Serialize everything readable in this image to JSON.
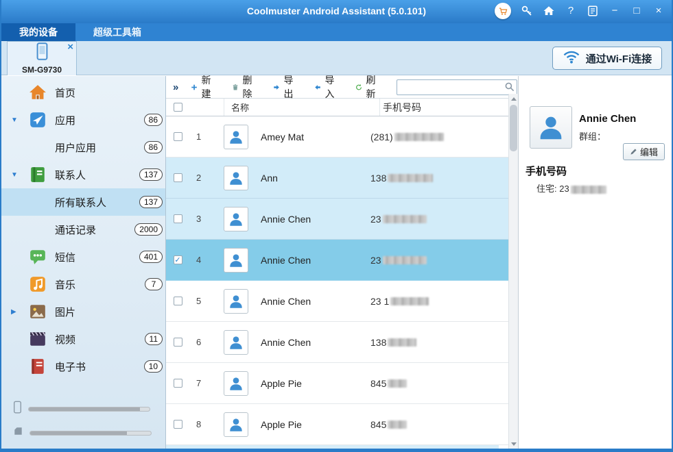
{
  "window": {
    "title": "Coolmuster Android Assistant (5.0.101)"
  },
  "icons": {
    "close": "×",
    "minimize": "−",
    "maximize": "□",
    "help": "?",
    "device_close": "×",
    "arrow_down": "▼",
    "arrow_right": "▶",
    "collapse": "»",
    "check": "✓"
  },
  "tabs": [
    {
      "label": "我的设备",
      "active": true
    },
    {
      "label": "超级工具箱",
      "active": false
    }
  ],
  "device": {
    "name": "SM-G9730"
  },
  "wifi_button": {
    "label": "通过Wi-Fi连接"
  },
  "sidebar": {
    "items": [
      {
        "label": "首页",
        "badge": "",
        "icon": "home"
      },
      {
        "label": "应用",
        "badge": "86",
        "icon": "apps",
        "arrow": "down"
      },
      {
        "label": "用户应用",
        "badge": "86"
      },
      {
        "label": "联系人",
        "badge": "137",
        "icon": "contacts",
        "arrow": "down"
      },
      {
        "label": "所有联系人",
        "badge": "137",
        "selected": true
      },
      {
        "label": "通话记录",
        "badge": "2000"
      },
      {
        "label": "短信",
        "badge": "401",
        "icon": "sms"
      },
      {
        "label": "音乐",
        "badge": "7",
        "icon": "music"
      },
      {
        "label": "图片",
        "badge": "",
        "icon": "photos",
        "arrow": "right"
      },
      {
        "label": "视频",
        "badge": "11",
        "icon": "videos"
      },
      {
        "label": "电子书",
        "badge": "10",
        "icon": "ebooks"
      }
    ]
  },
  "toolbar": {
    "new_label": "新建",
    "delete_label": "删除",
    "export_label": "导出",
    "import_label": "导入",
    "refresh_label": "刷新",
    "search_value": ""
  },
  "table": {
    "col_name": "名称",
    "col_phone": "手机号码",
    "rows": [
      {
        "num": "1",
        "name": "Amey Mat",
        "phone_prefix": "(281) "
      },
      {
        "num": "2",
        "name": "Ann",
        "phone_prefix": "138"
      },
      {
        "num": "3",
        "name": "Annie Chen",
        "phone_prefix": "23 "
      },
      {
        "num": "4",
        "name": "Annie Chen",
        "phone_prefix": "23 "
      },
      {
        "num": "5",
        "name": "Annie Chen",
        "phone_prefix": "23 1"
      },
      {
        "num": "6",
        "name": "Annie Chen",
        "phone_prefix": "138 "
      },
      {
        "num": "7",
        "name": "Apple Pie",
        "phone_prefix": "845"
      },
      {
        "num": "8",
        "name": "Apple Pie",
        "phone_prefix": "845"
      }
    ]
  },
  "detail": {
    "name": "Annie Chen",
    "group_label": "群组：",
    "edit_label": "编辑",
    "phone_heading": "手机号码",
    "home_line": "住宅: 23"
  },
  "colors": {
    "accent_blue": "#2e86d0",
    "selected_row": "#84cce9",
    "highlight_row": "#d2ecf9"
  }
}
